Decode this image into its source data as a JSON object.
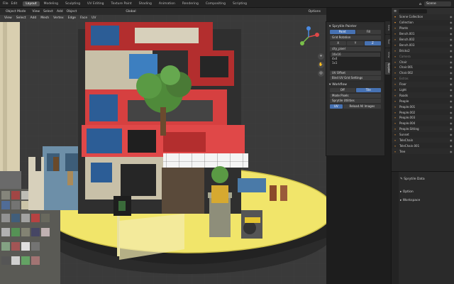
{
  "menu": [
    "File",
    "Edit"
  ],
  "tabs": [
    {
      "label": "Layout",
      "active": true
    },
    {
      "label": "Modeling"
    },
    {
      "label": "Sculpting"
    },
    {
      "label": "UV Editing"
    },
    {
      "label": "Texture Paint"
    },
    {
      "label": "Shading"
    },
    {
      "label": "Animation"
    },
    {
      "label": "Rendering"
    },
    {
      "label": "Compositing"
    },
    {
      "label": "Scripting"
    }
  ],
  "scene": "Scene",
  "viewport": {
    "header": [
      "Object Mode",
      "View",
      "Select",
      "Add",
      "Object"
    ],
    "header2": [
      "Global",
      "Options"
    ],
    "subheader": [
      "View",
      "Select",
      "Add",
      "Mesh",
      "Vertex",
      "Edge",
      "Face",
      "UV"
    ]
  },
  "npanel": {
    "sprytile_title": "Sprytile Painter",
    "paint_btns": [
      "Paint",
      "Fill"
    ],
    "grid_label": "Grid Rotation",
    "axis_btns": [
      "X",
      "Y",
      "Z"
    ],
    "list_title": "city_pixel",
    "list_items": [
      "16x16",
      "4x4",
      "1x1"
    ],
    "offset_label": "UV Offset",
    "bind_label": "Bind UV Grid Settings",
    "workflow_title": "Workflow",
    "workflow_btns": [
      "Off",
      "Tile"
    ],
    "mode_label": "Mode Pixels",
    "sprytile_utilities": "Sprytile Utilities",
    "bottom_btns": [
      "UV",
      "Reload All Images"
    ]
  },
  "side_tabs": [
    "Item",
    "Tool",
    "View",
    "Sprytile"
  ],
  "outliner": {
    "rows": [
      {
        "name": "Scene Collection",
        "dim": false
      },
      {
        "name": "Collection",
        "dim": false
      },
      {
        "name": "Plants",
        "dim": false
      },
      {
        "name": "Bench.001",
        "dim": false
      },
      {
        "name": "Bench.002",
        "dim": false
      },
      {
        "name": "Bench.003",
        "dim": false
      },
      {
        "name": "Bricks2",
        "dim": false
      },
      {
        "name": "Camera",
        "dim": true
      },
      {
        "name": "Chair",
        "dim": false
      },
      {
        "name": "Chair.001",
        "dim": false
      },
      {
        "name": "Chair.002",
        "dim": false
      },
      {
        "name": "Extras",
        "dim": true
      },
      {
        "name": "Floor",
        "dim": false
      },
      {
        "name": "Light",
        "dim": false
      },
      {
        "name": "Roads",
        "dim": false
      },
      {
        "name": "People",
        "dim": false
      },
      {
        "name": "People.001",
        "dim": false
      },
      {
        "name": "People.002",
        "dim": false
      },
      {
        "name": "People.003",
        "dim": false
      },
      {
        "name": "People.004",
        "dim": false
      },
      {
        "name": "People.Sitting",
        "dim": false
      },
      {
        "name": "Sunset",
        "dim": false
      },
      {
        "name": "TeleChain",
        "dim": false
      },
      {
        "name": "TeleChain.001",
        "dim": false
      },
      {
        "name": "Tree",
        "dim": false
      }
    ]
  },
  "props": {
    "title": "Sprytile Data",
    "items": [
      "Option",
      "Workspace"
    ]
  },
  "colors": {
    "accent": "#4772b3",
    "orange": "#f29a36",
    "yellow": "#f1e56a"
  }
}
